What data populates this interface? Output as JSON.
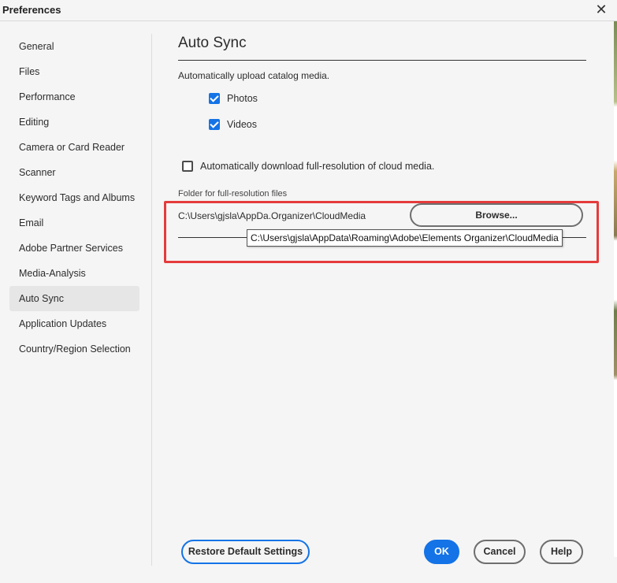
{
  "window": {
    "title": "Preferences",
    "close_glyph": "✕"
  },
  "sidebar": {
    "items": [
      {
        "label": "General"
      },
      {
        "label": "Files"
      },
      {
        "label": "Performance"
      },
      {
        "label": "Editing"
      },
      {
        "label": "Camera or Card Reader"
      },
      {
        "label": "Scanner"
      },
      {
        "label": "Keyword Tags and Albums"
      },
      {
        "label": "Email"
      },
      {
        "label": "Adobe Partner Services"
      },
      {
        "label": "Media-Analysis"
      },
      {
        "label": "Auto Sync",
        "active": true
      },
      {
        "label": "Application Updates"
      },
      {
        "label": "Country/Region Selection"
      }
    ]
  },
  "main": {
    "title": "Auto Sync",
    "subtitle": "Automatically upload catalog media.",
    "photos": {
      "label": "Photos",
      "checked": true
    },
    "videos": {
      "label": "Videos",
      "checked": true
    },
    "download": {
      "label": "Automatically download full-resolution of cloud media.",
      "checked": false
    },
    "folder_label": "Folder for full-resolution files",
    "folder_path": "C:\\Users\\gjsla\\AppDa.Organizer\\CloudMedia",
    "browse_label": "Browse...",
    "tooltip": "C:\\Users\\gjsla\\AppData\\Roaming\\Adobe\\Elements Organizer\\CloudMedia"
  },
  "footer": {
    "restore_label": "Restore Default Settings",
    "ok_label": "OK",
    "cancel_label": "Cancel",
    "help_label": "Help"
  },
  "colors": {
    "accent": "#1473e6",
    "highlight": "#e53b3b"
  }
}
